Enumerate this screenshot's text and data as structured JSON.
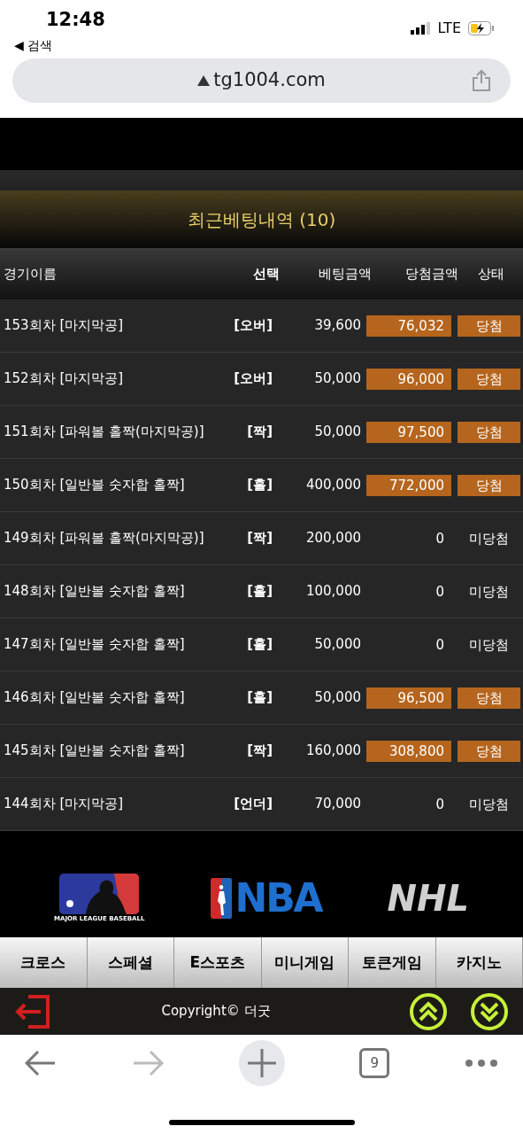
{
  "status_bar": {
    "time": "12:48",
    "back_label": "◀ 검색",
    "network": "LTE"
  },
  "address_bar": {
    "url": "tg1004.com"
  },
  "section": {
    "title": "최근베팅내역 (10)"
  },
  "table": {
    "columns": [
      "경기이름",
      "선택",
      "베팅금액",
      "당첨금액",
      "상태"
    ],
    "rows": [
      {
        "game": "153회차 [마지막공]",
        "pick": "[오버]",
        "bet": "39,600",
        "payout": "76,032",
        "status": "당첨",
        "won": true
      },
      {
        "game": "152회차 [마지막공]",
        "pick": "[오버]",
        "bet": "50,000",
        "payout": "96,000",
        "status": "당첨",
        "won": true
      },
      {
        "game": "151회차 [파워볼 홀짝(마지막공)]",
        "pick": "[짝]",
        "bet": "50,000",
        "payout": "97,500",
        "status": "당첨",
        "won": true
      },
      {
        "game": "150회차 [일반볼 숫자합 홀짝]",
        "pick": "[홀]",
        "bet": "400,000",
        "payout": "772,000",
        "status": "당첨",
        "won": true
      },
      {
        "game": "149회차 [파워볼 홀짝(마지막공)]",
        "pick": "[짝]",
        "bet": "200,000",
        "payout": "0",
        "status": "미당첨",
        "won": false
      },
      {
        "game": "148회차 [일반볼 숫자합 홀짝]",
        "pick": "[홀]",
        "bet": "100,000",
        "payout": "0",
        "status": "미당첨",
        "won": false
      },
      {
        "game": "147회차 [일반볼 숫자합 홀짝]",
        "pick": "[홀]",
        "bet": "50,000",
        "payout": "0",
        "status": "미당첨",
        "won": false
      },
      {
        "game": "146회차 [일반볼 숫자합 홀짝]",
        "pick": "[홀]",
        "bet": "50,000",
        "payout": "96,500",
        "status": "당첨",
        "won": true
      },
      {
        "game": "145회차 [일반볼 숫자합 홀짝]",
        "pick": "[짝]",
        "bet": "160,000",
        "payout": "308,800",
        "status": "당첨",
        "won": true
      },
      {
        "game": "144회차 [마지막공]",
        "pick": "[언더]",
        "bet": "70,000",
        "payout": "0",
        "status": "미당첨",
        "won": false
      }
    ]
  },
  "logos": {
    "mlb_caption": "MAJOR LEAGUE BASEBALL",
    "nba": "NBA",
    "nhl": "NHL"
  },
  "nav": [
    "크로스",
    "스페셜",
    "E스포츠",
    "미니게임",
    "토큰게임",
    "카지노"
  ],
  "footer": {
    "copyright": "Copyright© 더굿"
  },
  "browser_toolbar": {
    "tab_count": "9"
  }
}
